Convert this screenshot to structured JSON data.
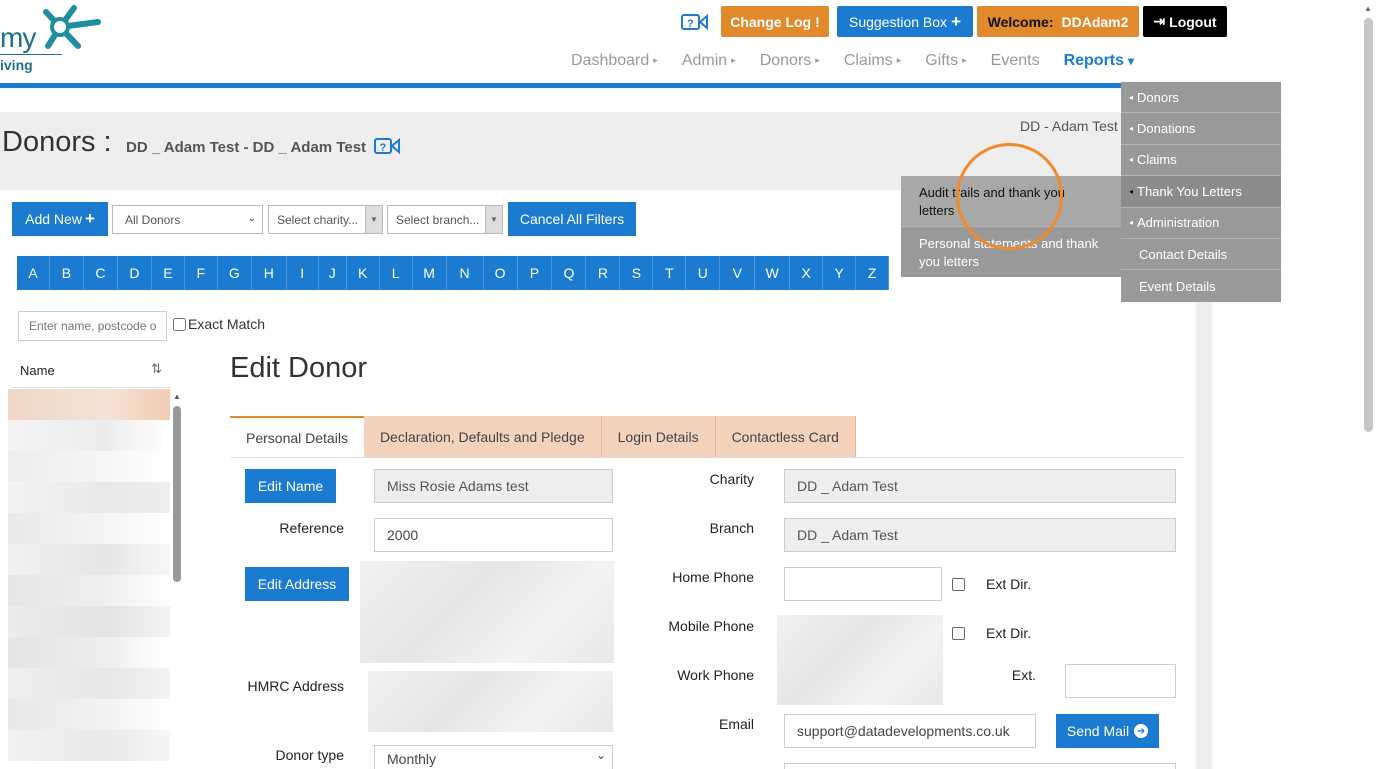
{
  "logo": {
    "text": "my",
    "sub": "iving"
  },
  "header": {
    "change_log": "Change Log",
    "change_log_icon": "!",
    "suggestion_box": "Suggestion Box",
    "suggestion_icon": "+",
    "welcome_label": "Welcome:",
    "welcome_user": "DDAdam2",
    "logout": "Logout",
    "logout_icon": "⇥"
  },
  "nav": {
    "items": [
      {
        "label": "Dashboard"
      },
      {
        "label": "Admin"
      },
      {
        "label": "Donors"
      },
      {
        "label": "Claims"
      },
      {
        "label": "Gifts"
      },
      {
        "label": "Events"
      },
      {
        "label": "Reports"
      }
    ],
    "caret": "▸",
    "active_caret": "▾"
  },
  "page": {
    "title": "Donors :",
    "subtitle": "DD _ Adam Test - DD _ Adam Test",
    "top_right_user": "DD - Adam Test"
  },
  "filters": {
    "add_new": "Add New",
    "add_icon": "+",
    "all_donors": "All Donors",
    "select_charity": "Select charity...",
    "select_branch": "Select branch...",
    "cancel_all": "Cancel All Filters"
  },
  "alphabet": [
    "A",
    "B",
    "C",
    "D",
    "E",
    "F",
    "G",
    "H",
    "I",
    "J",
    "K",
    "L",
    "M",
    "N",
    "O",
    "P",
    "Q",
    "R",
    "S",
    "T",
    "U",
    "V",
    "W",
    "X",
    "Y",
    "Z"
  ],
  "search": {
    "placeholder": "Enter name, postcode or",
    "exact_match": "Exact Match"
  },
  "list": {
    "header": "Name",
    "sort_icon": "⇅"
  },
  "edit": {
    "title": "Edit Donor",
    "tabs": [
      {
        "label": "Personal Details"
      },
      {
        "label": "Declaration, Defaults and Pledge"
      },
      {
        "label": "Login Details"
      },
      {
        "label": "Contactless Card"
      }
    ],
    "edit_name": "Edit Name",
    "name_value": "Miss Rosie Adams test",
    "reference_label": "Reference",
    "reference_value": "2000",
    "edit_address": "Edit Address",
    "hmrc_label": "HMRC Address",
    "donor_type_label": "Donor type",
    "donor_type_value": "Monthly",
    "charity_label": "Charity",
    "charity_value": "DD _ Adam Test",
    "branch_label": "Branch",
    "branch_value": "DD _ Adam Test",
    "home_phone_label": "Home Phone",
    "mobile_phone_label": "Mobile Phone",
    "work_phone_label": "Work Phone",
    "ext_dir": "Ext Dir.",
    "ext": "Ext.",
    "email_label": "Email",
    "email_value": "support@datadevelopments.co.uk",
    "send_mail": "Send Mail",
    "send_mail_icon": "➜"
  },
  "reports_menu": {
    "items": [
      {
        "label": "Donors"
      },
      {
        "label": "Donations"
      },
      {
        "label": "Claims"
      },
      {
        "label": "Thank You Letters"
      },
      {
        "label": "Administration"
      },
      {
        "label": "Contact Details"
      },
      {
        "label": "Event Details"
      }
    ],
    "submenu": [
      {
        "label": "Audit trails and thank you letters"
      },
      {
        "label": "Personal statements and thank you letters"
      }
    ],
    "tri": "◂"
  },
  "colors": {
    "primary": "#1a7bd1",
    "accent": "#e08a2c",
    "menu": "#999999"
  }
}
